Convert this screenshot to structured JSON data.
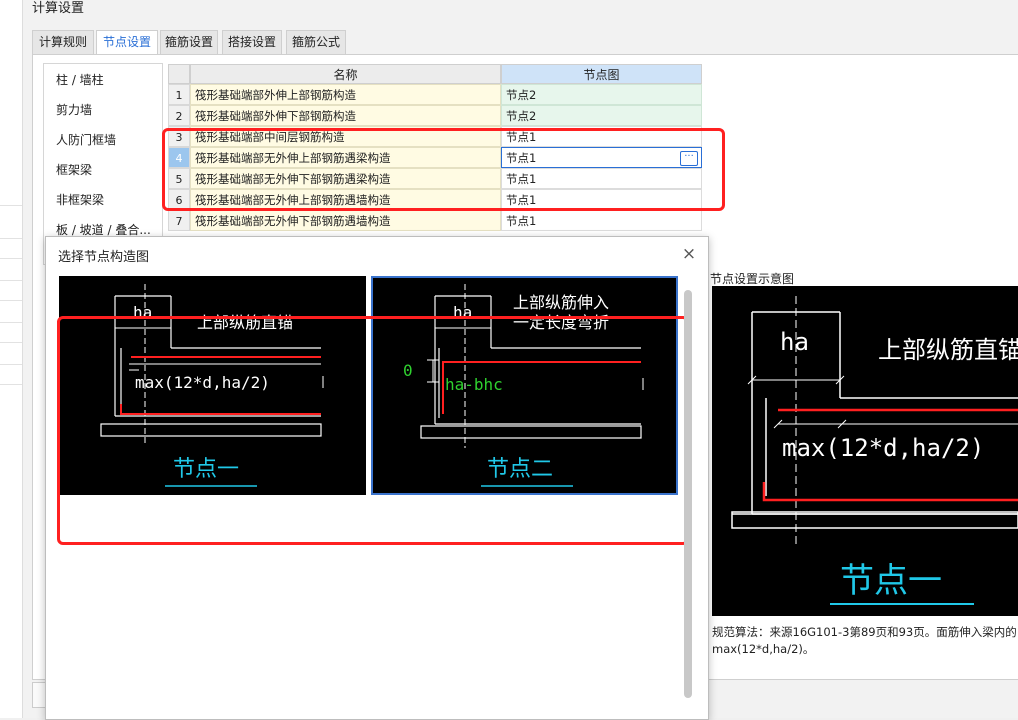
{
  "window": {
    "title": "计算设置"
  },
  "tabs": [
    {
      "label": "计算规则"
    },
    {
      "label": "节点设置"
    },
    {
      "label": "箍筋设置"
    },
    {
      "label": "搭接设置"
    },
    {
      "label": "箍筋公式"
    }
  ],
  "sidebar": {
    "items": [
      {
        "label": "柱 / 墙柱"
      },
      {
        "label": "剪力墙"
      },
      {
        "label": "人防门框墙"
      },
      {
        "label": "框架梁"
      },
      {
        "label": "非框架梁"
      },
      {
        "label": "板 / 坡道 / 叠合..."
      }
    ]
  },
  "grid": {
    "columns": [
      "名称",
      "节点图"
    ],
    "rows": [
      {
        "num": "1",
        "name": "筏形基础端部外伸上部钢筋构造",
        "node": "节点2"
      },
      {
        "num": "2",
        "name": "筏形基础端部外伸下部钢筋构造",
        "node": "节点2"
      },
      {
        "num": "3",
        "name": "筏形基础端部中间层钢筋构造",
        "node": "节点1"
      },
      {
        "num": "4",
        "name": "筏形基础端部无外伸上部钢筋遇梁构造",
        "node": "节点1"
      },
      {
        "num": "5",
        "name": "筏形基础端部无外伸下部钢筋遇梁构造",
        "node": "节点1"
      },
      {
        "num": "6",
        "name": "筏形基础端部无外伸上部钢筋遇墙构造",
        "node": "节点1"
      },
      {
        "num": "7",
        "name": "筏形基础端部无外伸下部钢筋遇墙构造",
        "node": "节点1"
      }
    ],
    "ellipsis": "···"
  },
  "dialog": {
    "title": "选择节点构造图",
    "close": "×",
    "option1": {
      "ha": "ha",
      "text": "上部纵筋直锚",
      "formula": "max(12*d,ha/2)",
      "caption": "节点一"
    },
    "option2": {
      "ha": "ha",
      "text1": "上部纵筋伸入",
      "text2": "一定长度弯折",
      "zero": "0",
      "formula": "ha-bhc",
      "caption": "节点二"
    }
  },
  "preview": {
    "title": "节点设置示意图",
    "ha": "ha",
    "text": "上部纵筋直锚",
    "formula": "max(12*d,ha/2)",
    "caption": "节点一",
    "description": "规范算法：来源16G101-3第89页和93页。面筋伸入梁内的max(12*d,ha/2)。"
  },
  "colors": {
    "accent": "#2a6fd6",
    "highlight": "#ff2020",
    "cad_bg": "#000000",
    "caption": "#20c8e8",
    "rebar": "#ff2020",
    "green": "#2fd12f"
  }
}
